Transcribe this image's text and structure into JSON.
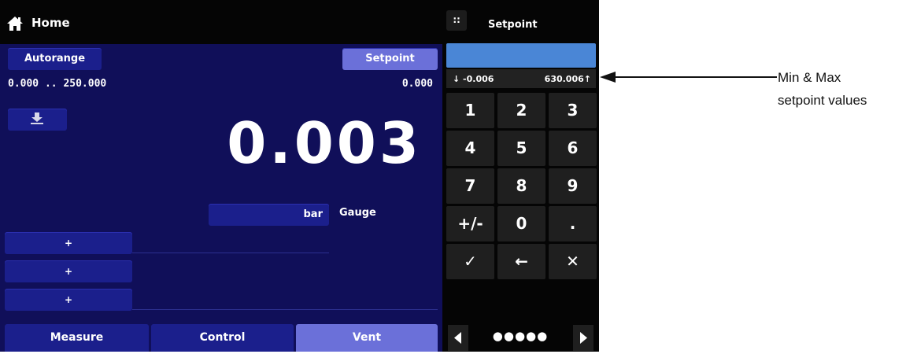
{
  "header": {
    "title": "Home",
    "icon": "home-icon"
  },
  "main": {
    "autorange_label": "Autorange",
    "range_text": "0.000 .. 250.000",
    "setpoint_label": "Setpoint",
    "setpoint_value": "0.000",
    "zero_icon": "tare-arrow-icon",
    "reading": "0.003",
    "unit": "bar",
    "mode": "Gauge",
    "plus_buttons": [
      "+",
      "+",
      "+"
    ]
  },
  "nav": {
    "measure": "Measure",
    "control": "Control",
    "vent": "Vent"
  },
  "keypad": {
    "title": "Setpoint",
    "grid_icon": "∷",
    "entry_value": "",
    "min_text": "↓ -0.006",
    "max_text": "630.006↑",
    "keys": [
      "1",
      "2",
      "3",
      "4",
      "5",
      "6",
      "7",
      "8",
      "9",
      "+/-",
      "0",
      ".",
      "✓",
      "←",
      "✕"
    ],
    "pager_dots": "●●●●●"
  },
  "annotation": {
    "line1": "Min & Max",
    "line2": "setpoint values"
  },
  "colors": {
    "screen_bg": "#100f59",
    "button": "#1b1f8c",
    "button_active": "#6b70d9",
    "entry": "#4a86d6"
  }
}
